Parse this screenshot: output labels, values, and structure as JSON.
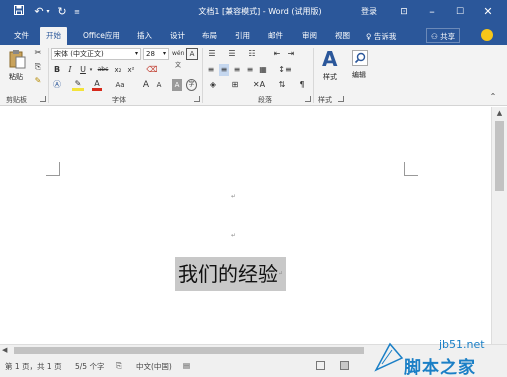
{
  "titlebar": {
    "title": "文档1 [兼容模式] - Word (试用版)",
    "login": "登录",
    "save_icon": "save-icon",
    "undo_icon": "undo-icon",
    "redo_icon": "redo-icon",
    "customize_icon": "customize-icon"
  },
  "tabs": [
    "文件",
    "开始",
    "Office应用",
    "插入",
    "设计",
    "布局",
    "引用",
    "邮件",
    "审阅",
    "视图"
  ],
  "active_tab": "开始",
  "tellme": "告诉我",
  "share": "共享",
  "ribbon": {
    "paste_label": "粘贴",
    "clipboard_label": "剪贴板",
    "font_name": "宋体 (中文正文)",
    "font_size": "28",
    "font_group_label": "字体",
    "paragraph_group_label": "段落",
    "styles_label": "样式",
    "styles_group_label": "样式",
    "editing_label": "编辑",
    "bold": "B",
    "italic": "I",
    "underline": "U",
    "strike": "abc",
    "subscript": "x₂",
    "superscript": "x²",
    "grow_font": "A",
    "shrink_font": "A",
    "change_case": "Aa",
    "wen_button": "wén 文"
  },
  "document": {
    "text": "我们的经验",
    "para_mark": "↵"
  },
  "status": {
    "page": "第 1 页，共 1 页",
    "words": "5/5 个字",
    "language": "中文(中国)"
  },
  "watermark": {
    "url": "jb51.net",
    "name": "脚本之家"
  },
  "colors": {
    "accent": "#2b579a",
    "ribbon_bg": "#f3f3f3",
    "selection": "#c8c8c8"
  }
}
